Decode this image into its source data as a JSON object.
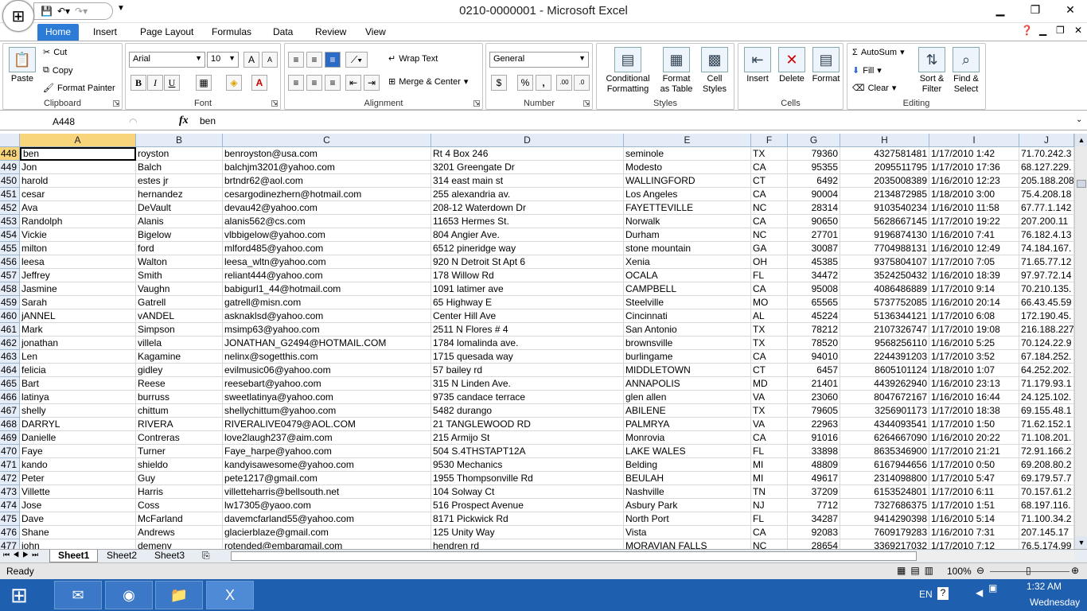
{
  "window": {
    "title": "0210-0000001 - Microsoft Excel"
  },
  "tabs": [
    "Home",
    "Insert",
    "Page Layout",
    "Formulas",
    "Data",
    "Review",
    "View"
  ],
  "clipboard": {
    "paste": "Paste",
    "cut": "Cut",
    "copy": "Copy",
    "format_painter": "Format Painter",
    "label": "Clipboard"
  },
  "font": {
    "name": "Arial",
    "size": "10",
    "label": "Font",
    "bold": "B",
    "italic": "I",
    "underline": "U"
  },
  "alignment": {
    "wrap_text": "Wrap Text",
    "merge_center": "Merge & Center",
    "label": "Alignment"
  },
  "number": {
    "format": "General",
    "label": "Number",
    "currency": "$",
    "percent": "%",
    "comma": ","
  },
  "styles": {
    "conditional": "Conditional",
    "formatting": "Formatting",
    "format": "Format",
    "as_table": "as Table",
    "cell": "Cell",
    "cell_styles": "Styles",
    "label": "Styles"
  },
  "cells": {
    "insert": "Insert",
    "delete": "Delete",
    "format": "Format",
    "label": "Cells"
  },
  "editing": {
    "autosum": "AutoSum",
    "fill": "Fill",
    "clear": "Clear",
    "sort": "Sort &",
    "filter": "Filter",
    "find": "Find &",
    "select": "Select",
    "label": "Editing"
  },
  "formula_bar": {
    "name_box": "A448",
    "fx": "fx",
    "value": "ben"
  },
  "columns": [
    "A",
    "B",
    "C",
    "D",
    "E",
    "F",
    "G",
    "H",
    "I",
    "J"
  ],
  "rows": [
    {
      "n": "448",
      "c": [
        "ben",
        "royston",
        "benroyston@usa.com",
        "Rt 4 Box 246",
        "seminole",
        "TX",
        "79360",
        "4327581481",
        "1/17/2010 1:42",
        "71.70.242.3"
      ]
    },
    {
      "n": "449",
      "c": [
        "Jon",
        "Balch",
        "balchjm3201@yahoo.com",
        "3201 Greengate Dr",
        "Modesto",
        "CA",
        "95355",
        "2095511795",
        "1/17/2010 17:36",
        "68.127.229."
      ]
    },
    {
      "n": "450",
      "c": [
        "harold",
        "estes jr",
        "brtndr62@aol.com",
        "314 east main st",
        "WALLINGFORD",
        "CT",
        "6492",
        "2035008389",
        "1/16/2010 12:23",
        "205.188.208"
      ]
    },
    {
      "n": "451",
      "c": [
        "cesar",
        "hernandez",
        "cesargodinezhern@hotmail.com",
        "255 alexandria av.",
        "Los Angeles",
        "CA",
        "90004",
        "2134872985",
        "1/18/2010 3:00",
        "75.4.208.18"
      ]
    },
    {
      "n": "452",
      "c": [
        "Ava",
        "DeVault",
        "devau42@yahoo.com",
        "208-12 Waterdown Dr",
        "FAYETTEVILLE",
        "NC",
        "28314",
        "9103540234",
        "1/16/2010 11:58",
        "67.77.1.142"
      ]
    },
    {
      "n": "453",
      "c": [
        "Randolph",
        "Alanis",
        "alanis562@cs.com",
        "11653 Hermes St.",
        "Norwalk",
        "CA",
        "90650",
        "5628667145",
        "1/17/2010 19:22",
        "207.200.11"
      ]
    },
    {
      "n": "454",
      "c": [
        "Vickie",
        "Bigelow",
        "vlbbigelow@yahoo.com",
        "804 Angier Ave.",
        "Durham",
        "NC",
        "27701",
        "9196874130",
        "1/16/2010 7:41",
        "76.182.4.13"
      ]
    },
    {
      "n": "455",
      "c": [
        "milton",
        "ford",
        "mlford485@yahoo.com",
        "6512 pineridge way",
        "stone mountain",
        "GA",
        "30087",
        "7704988131",
        "1/16/2010 12:49",
        "74.184.167."
      ]
    },
    {
      "n": "456",
      "c": [
        "leesa",
        "Walton",
        "leesa_wltn@yahoo.com",
        "920 N  Detroit St Apt 6",
        "Xenia",
        "OH",
        "45385",
        "9375804107",
        "1/17/2010 7:05",
        "71.65.77.12"
      ]
    },
    {
      "n": "457",
      "c": [
        "Jeffrey",
        "Smith",
        "reliant444@yahoo.com",
        "178 Willow Rd",
        "OCALA",
        "FL",
        "34472",
        "3524250432",
        "1/16/2010 18:39",
        "97.97.72.14"
      ]
    },
    {
      "n": "458",
      "c": [
        "Jasmine",
        "Vaughn",
        "babigurl1_44@hotmail.com",
        "1091 latimer ave",
        "CAMPBELL",
        "CA",
        "95008",
        "4086486889",
        "1/17/2010 9:14",
        "70.210.135."
      ]
    },
    {
      "n": "459",
      "c": [
        "Sarah",
        "Gatrell",
        "gatrell@misn.com",
        "65 Highway E",
        "Steelville",
        "MO",
        "65565",
        "5737752085",
        "1/16/2010 20:14",
        "66.43.45.59"
      ]
    },
    {
      "n": "460",
      "c": [
        "jANNEL",
        "vANDEL",
        "asknaklsd@yahoo.com",
        "Center Hill Ave",
        "Cincinnati",
        "AL",
        "45224",
        "5136344121",
        "1/17/2010 6:08",
        "172.190.45."
      ]
    },
    {
      "n": "461",
      "c": [
        "Mark",
        "Simpson",
        "msimp63@yahoo.com",
        "2511 N Flores # 4",
        "San Antonio",
        "TX",
        "78212",
        "2107326747",
        "1/17/2010 19:08",
        "216.188.227"
      ]
    },
    {
      "n": "462",
      "c": [
        "jonathan",
        "villela",
        "JONATHAN_G2494@HOTMAIL.COM",
        "1784 lomalinda ave.",
        "brownsville",
        "TX",
        "78520",
        "9568256110",
        "1/16/2010 5:25",
        "70.124.22.9"
      ]
    },
    {
      "n": "463",
      "c": [
        "Len",
        "Kagamine",
        "nelinx@sogetthis.com",
        "1715 quesada way",
        "burlingame",
        "CA",
        "94010",
        "2244391203",
        "1/17/2010 3:52",
        "67.184.252."
      ]
    },
    {
      "n": "464",
      "c": [
        "felicia",
        "gidley",
        "evilmusic06@yahoo.com",
        "57 bailey rd",
        "MIDDLETOWN",
        "CT",
        "6457",
        "8605101124",
        "1/18/2010 1:07",
        "64.252.202."
      ]
    },
    {
      "n": "465",
      "c": [
        "Bart",
        "Reese",
        "reesebart@yahoo.com",
        "315 N Linden Ave.",
        "ANNAPOLIS",
        "MD",
        "21401",
        "4439262940",
        "1/16/2010 23:13",
        "71.179.93.1"
      ]
    },
    {
      "n": "466",
      "c": [
        "latinya",
        "burruss",
        "sweetlatinya@yahoo.com",
        "9735 candace terrace",
        "glen allen",
        "VA",
        "23060",
        "8047672167",
        "1/16/2010 16:44",
        "24.125.102."
      ]
    },
    {
      "n": "467",
      "c": [
        "shelly",
        "chittum",
        "shellychittum@yahoo.com",
        "5482 durango",
        "ABILENE",
        "TX",
        "79605",
        "3256901173",
        "1/17/2010 18:38",
        "69.155.48.1"
      ]
    },
    {
      "n": "468",
      "c": [
        "DARRYL",
        "RIVERA",
        "RIVERALIVE0479@AOL.COM",
        "21 TANGLEWOOD RD",
        "PALMRYA",
        "VA",
        "22963",
        "4344093541",
        "1/17/2010 1:50",
        "71.62.152.1"
      ]
    },
    {
      "n": "469",
      "c": [
        "Danielle",
        "Contreras",
        "love2laugh237@aim.com",
        "215 Armijo St",
        "Monrovia",
        "CA",
        "91016",
        "6264667090",
        "1/16/2010 20:22",
        "71.108.201."
      ]
    },
    {
      "n": "470",
      "c": [
        "Faye",
        "Turner",
        "Faye_harpe@yahoo.com",
        "504 S.4THSTAPT12A",
        "LAKE WALES",
        "FL",
        "33898",
        "8635346900",
        "1/17/2010 21:21",
        "72.91.166.2"
      ]
    },
    {
      "n": "471",
      "c": [
        "kando",
        "shieldo",
        "kandyisawesome@yahoo.com",
        "9530 Mechanics",
        "Belding",
        "MI",
        "48809",
        "6167944656",
        "1/17/2010 0:50",
        "69.208.80.2"
      ]
    },
    {
      "n": "472",
      "c": [
        "Peter",
        "Guy",
        "pete1217@gmail.com",
        "1955 Thompsonville Rd",
        "BEULAH",
        "MI",
        "49617",
        "2314098800",
        "1/17/2010 5:47",
        "69.179.57.7"
      ]
    },
    {
      "n": "473",
      "c": [
        "Villette",
        "Harris",
        "villetteharris@bellsouth.net",
        "104 Solway Ct",
        "Nashville",
        "TN",
        "37209",
        "6153524801",
        "1/17/2010 6:11",
        "70.157.61.2"
      ]
    },
    {
      "n": "474",
      "c": [
        "Jose",
        "Coss",
        "lw17305@yaoo.com",
        "516 Prospect Avenue",
        "Asbury Park",
        "NJ",
        "7712",
        "7327686375",
        "1/17/2010 1:51",
        "68.197.116."
      ]
    },
    {
      "n": "475",
      "c": [
        "Dave",
        "McFarland",
        "davemcfarland55@yahoo.com",
        "8171 Pickwick Rd",
        "North Port",
        "FL",
        "34287",
        "9414290398",
        "1/16/2010 5:14",
        "71.100.34.2"
      ]
    },
    {
      "n": "476",
      "c": [
        "Shane",
        "Andrews",
        "glacierblaze@gmail.com",
        "125 Unity Way",
        "Vista",
        "CA",
        "92083",
        "7609179283",
        "1/16/2010 7:31",
        "207.145.17"
      ]
    },
    {
      "n": "477",
      "c": [
        "john",
        "demeny",
        "rotended@embargmail.com",
        "hendren rd",
        "MORAVIAN FALLS",
        "NC",
        "28654",
        "3369217032",
        "1/17/2010 7:12",
        "76.5.174.99"
      ]
    }
  ],
  "sheets": [
    "Sheet1",
    "Sheet2",
    "Sheet3"
  ],
  "status": {
    "ready": "Ready",
    "zoom": "100%"
  },
  "taskbar": {
    "lang": "EN",
    "time": "1:32 AM",
    "day": "Wednesday"
  }
}
